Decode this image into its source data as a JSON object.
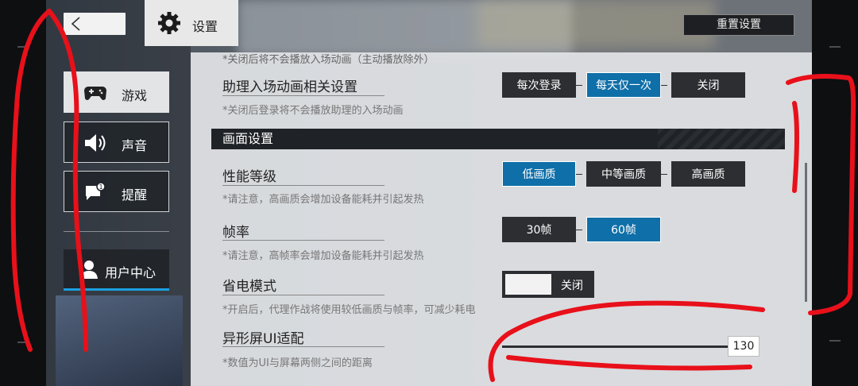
{
  "header": {
    "back_icon": "chevron-left-icon",
    "settings_icon": "gear-icon",
    "settings_label": "设置",
    "reset_label": "重置设置"
  },
  "sidebar": {
    "items": [
      {
        "label": "游戏",
        "icon": "gamepad-icon",
        "active": true
      },
      {
        "label": "声音",
        "icon": "speaker-icon",
        "active": false
      },
      {
        "label": "提醒",
        "icon": "notification-icon",
        "active": false
      }
    ],
    "user_center": {
      "label": "用户中心",
      "icon": "user-icon"
    }
  },
  "main": {
    "cut_hint": "*关闭后将不会播放入场动画（主动播放除外）",
    "assistant": {
      "title": "助理入场动画相关设置",
      "hint": "*关闭后登录将不会播放助理的入场动画",
      "options": [
        "每次登录",
        "每天仅一次",
        "关闭"
      ],
      "selected": 1
    },
    "section_title": "画面设置",
    "performance": {
      "title": "性能等级",
      "hint": "*请注意，高画质会增加设备能耗并引起发热",
      "options": [
        "低画质",
        "中等画质",
        "高画质"
      ],
      "selected": 0
    },
    "framerate": {
      "title": "帧率",
      "hint": "*请注意，高帧率会增加设备能耗并引起发热",
      "options": [
        "30帧",
        "60帧"
      ],
      "selected": 1
    },
    "power_save": {
      "title": "省电模式",
      "hint": "*开启后，代理作战将使用较低画质与帧率，可减少耗电",
      "toggle_label": "关闭"
    },
    "notch": {
      "title": "异形屏UI适配",
      "hint": "*数值为UI与屏幕两侧之间的距离",
      "value": "130"
    }
  },
  "colors": {
    "accent": "#0f6fa8",
    "annotation": "#e8101a"
  }
}
